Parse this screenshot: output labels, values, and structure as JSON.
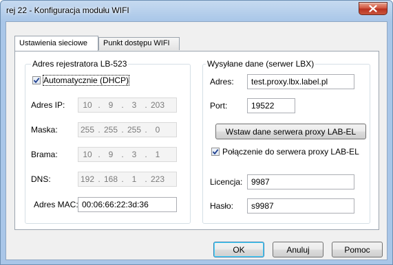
{
  "window": {
    "title": "rej 22 - Konfiguracja modułu WIFI"
  },
  "tabs": [
    {
      "label": "Ustawienia sieciowe",
      "active": true
    },
    {
      "label": "Punkt dostępu WIFI",
      "active": false
    }
  ],
  "recorder_group": {
    "title": "Adres rejestratora LB-523",
    "dhcp_label": "Automatycznie (DHCP)",
    "dhcp_checked": true,
    "ip": {
      "label": "Adres IP:",
      "octets": [
        "10",
        "9",
        "3",
        "203"
      ]
    },
    "mask": {
      "label": "Maska:",
      "octets": [
        "255",
        "255",
        "255",
        "0"
      ]
    },
    "gateway": {
      "label": "Brama:",
      "octets": [
        "10",
        "9",
        "3",
        "1"
      ]
    },
    "dns": {
      "label": "DNS:",
      "octets": [
        "192",
        "168",
        "1",
        "223"
      ]
    },
    "mac": {
      "label": "Adres MAC:",
      "value": "00:06:66:22:3d:36"
    }
  },
  "server_group": {
    "title": "Wysyłane dane (serwer LBX)",
    "address": {
      "label": "Adres:",
      "value": "test.proxy.lbx.label.pl"
    },
    "port": {
      "label": "Port:",
      "value": "19522"
    },
    "insert_button": "Wstaw dane serwera proxy LAB-EL",
    "proxy_label": "Połączenie do serwera proxy LAB-EL",
    "proxy_checked": true,
    "license": {
      "label": "Licencja:",
      "value": "9987"
    },
    "password": {
      "label": "Hasło:",
      "value": "s9987"
    }
  },
  "buttons": {
    "ok": "OK",
    "cancel": "Anuluj",
    "help": "Pomoc"
  },
  "colors": {
    "title_bar": "#a9c6e8",
    "close_button": "#c9553c",
    "default_button_border": "#3c7fb1"
  }
}
